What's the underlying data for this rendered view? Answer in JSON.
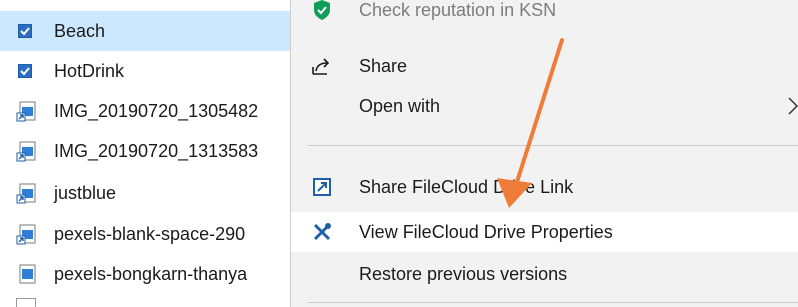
{
  "explorer": {
    "files": [
      {
        "name": "Beach",
        "checked": true,
        "selected": true,
        "icon": "image-file-icon"
      },
      {
        "name": "HotDrink",
        "checked": true,
        "selected": false,
        "icon": "image-file-icon"
      },
      {
        "name": "IMG_20190720_1305482",
        "checked": false,
        "selected": false,
        "icon": "image-file-icon"
      },
      {
        "name": "IMG_20190720_1313583",
        "checked": false,
        "selected": false,
        "icon": "image-file-icon"
      },
      {
        "name": "justblue",
        "checked": false,
        "selected": false,
        "icon": "image-file-icon"
      },
      {
        "name": "pexels-blank-space-290",
        "checked": false,
        "selected": false,
        "icon": "image-file-icon"
      },
      {
        "name": "pexels-bongkarn-thanya",
        "checked": false,
        "selected": false,
        "icon": "image-file-icon"
      }
    ]
  },
  "context_menu": {
    "items": [
      {
        "label": "Check reputation in KSN",
        "icon": "kaspersky-shield-icon"
      },
      {
        "label": "Share",
        "icon": "share-icon"
      },
      {
        "label": "Open with",
        "icon": "",
        "has_submenu": true
      },
      {
        "label": "Share FileCloud Drive Link",
        "icon": "filecloud-link-icon"
      },
      {
        "label": "View FileCloud Drive Properties",
        "icon": "tools-icon",
        "highlighted": true
      },
      {
        "label": "Restore previous versions",
        "icon": ""
      }
    ]
  },
  "colors": {
    "selection": "#cce8ff",
    "menu_background": "#f2f2f2",
    "menu_hover": "#ffffff",
    "annotation_arrow": "#f07c3a",
    "icon_blue": "#1e5fa8",
    "kaspersky_green": "#0f9d58"
  }
}
